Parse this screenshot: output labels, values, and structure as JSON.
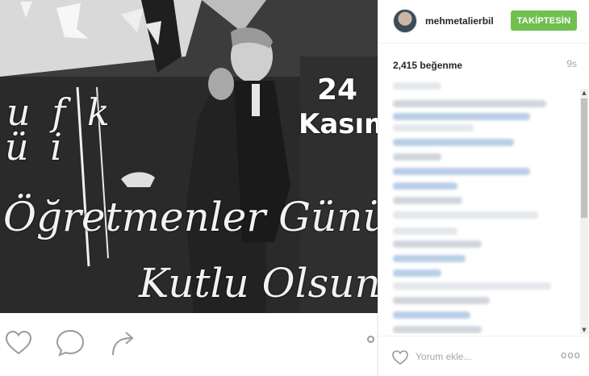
{
  "post": {
    "image": {
      "chalk_top": "u  f k",
      "chalk_top2": "ü i   ",
      "text_line1": "Öğretmenler Gününüz",
      "text_line2": "Kutlu Olsun",
      "date_day": "24",
      "date_month": "Kasım"
    },
    "actions": {
      "like_icon": "heart-outline-icon",
      "comment_icon": "speech-bubble-icon",
      "share_icon": "share-arrow-icon"
    }
  },
  "sidebar": {
    "username": "mehmetalierbil",
    "follow_label": "TAKİPTESİN",
    "likes": "2,415 beğenme",
    "age": "9s",
    "comment_placeholder": "Yorum ekle...",
    "more_label": "ooo",
    "scroll_up": "▲",
    "scroll_down": "▼"
  },
  "colors": {
    "follow_button": "#70c050",
    "muted_text": "#a5a7aa",
    "photo_background": "#3a3a3a"
  }
}
